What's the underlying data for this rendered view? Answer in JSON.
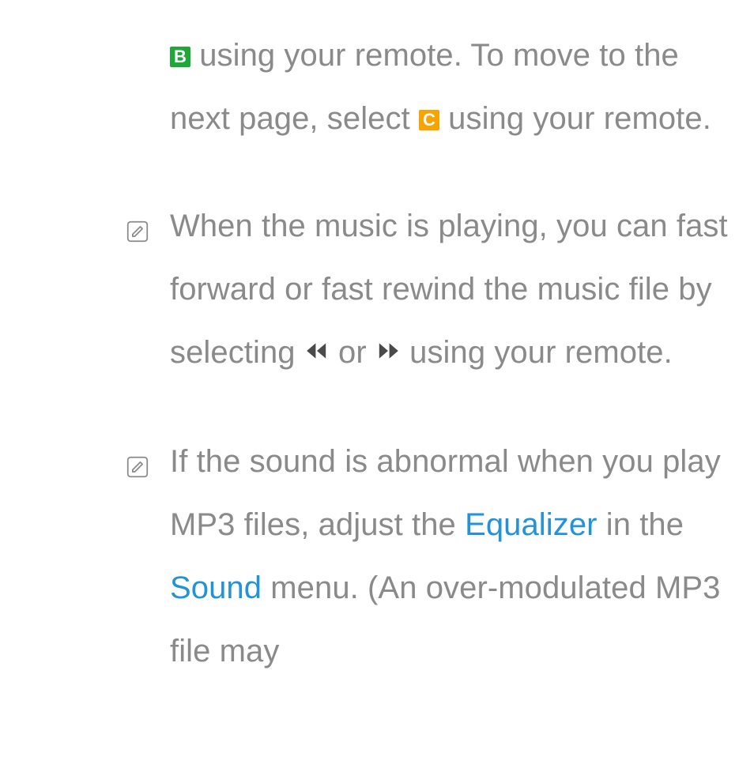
{
  "colors": {
    "text": "#8a8a8a",
    "link": "#2393d9",
    "key_green": "#1ea838",
    "key_yellow": "#f7a400"
  },
  "icons": {
    "note": "note-pencil-icon",
    "key_b": "B",
    "key_c": "C",
    "rewind": "rewind-icon",
    "forward": "fast-forward-icon"
  },
  "paragraphs": {
    "p1": {
      "t1": " using your remote. To move to the next page, select ",
      "t2": " using your remote."
    },
    "p2": {
      "t1": "When the music is playing, you can fast forward or fast rewind the music file by selecting ",
      "t2": " or ",
      "t3": " using your remote."
    },
    "p3": {
      "t1": "If the sound is abnormal when you play MP3 files, adjust the ",
      "link1": "Equalizer",
      "t2": " in the ",
      "link2": "Sound",
      "t3": " menu. (An over-modulated MP3 file may"
    }
  }
}
